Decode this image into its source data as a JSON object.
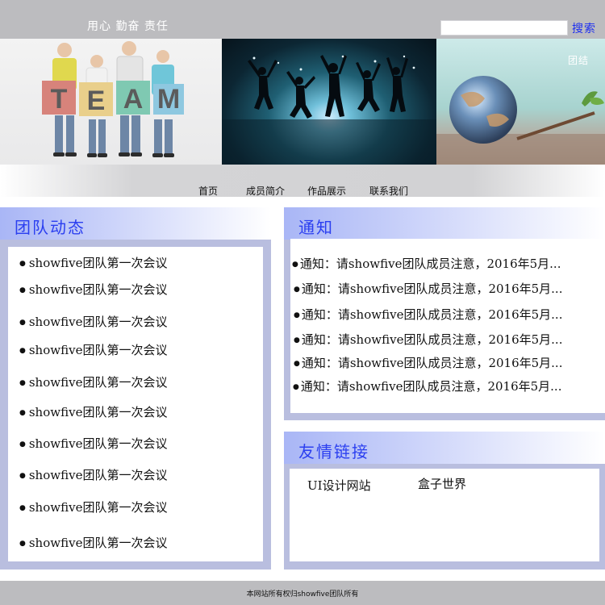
{
  "header": {
    "slogan": "用心 勤奋 责任",
    "search_placeholder": "",
    "search_label": "搜索"
  },
  "banner": {
    "team_letters": [
      "T",
      "E",
      "A",
      "M"
    ],
    "team_letter_colors": [
      "#d7837b",
      "#e9cf8b",
      "#7fc9b2",
      "#8ec8e0"
    ],
    "third_caption": "团结"
  },
  "nav": {
    "items": [
      "首页",
      "成员简介",
      "作品展示",
      "联系我们"
    ]
  },
  "team_news": {
    "title": "团队动态",
    "items": [
      "showfive团队第一次会议",
      "showfive团队第一次会议",
      "showfive团队第一次会议",
      "showfive团队第一次会议",
      "showfive团队第一次会议",
      "showfive团队第一次会议",
      "showfive团队第一次会议",
      "showfive团队第一次会议",
      "showfive团队第一次会议",
      "showfive团队第一次会议"
    ]
  },
  "notice": {
    "title": "通知",
    "items": [
      "通知：请showfive团队成员注意，2016年5月...",
      "通知：请showfive团队成员注意，2016年5月...",
      "通知：请showfive团队成员注意，2016年5月...",
      "通知：请showfive团队成员注意，2016年5月...",
      "通知：请showfive团队成员注意，2016年5月...",
      "通知：请showfive团队成员注意，2016年5月..."
    ]
  },
  "links": {
    "title": "友情链接",
    "items": [
      "UI设计网站",
      "盒子世界"
    ]
  },
  "footer": {
    "copyright": "本网站所有权归showfive团队所有"
  },
  "colors": {
    "accent_blue": "#2b3ff0",
    "panel_border": "#b9bedf",
    "top_bar": "#bcbcbf"
  }
}
